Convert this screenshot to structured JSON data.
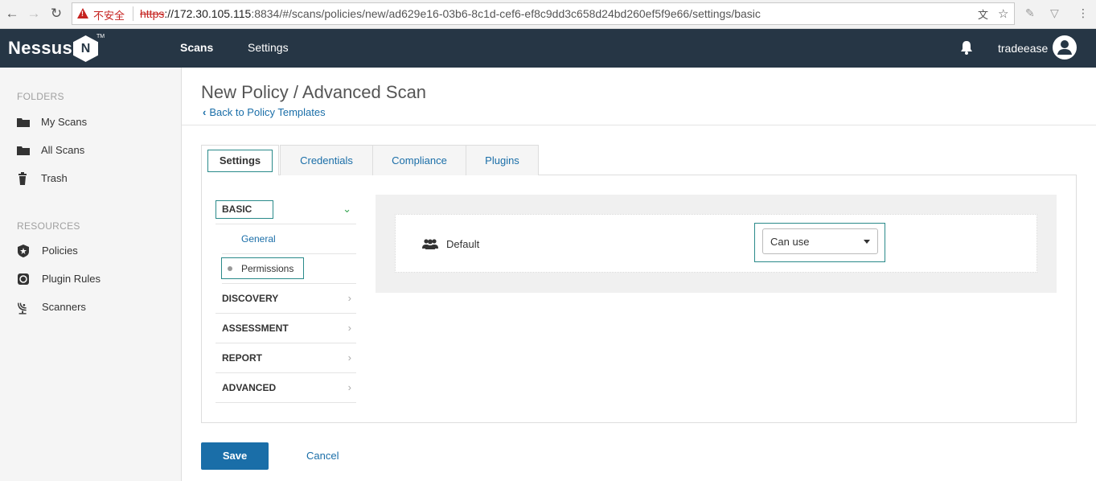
{
  "browser": {
    "insecure_label": "不安全",
    "url_scheme": "https",
    "url_host": "://172.30.105.115",
    "url_rest": ":8834/#/scans/policies/new/ad629e16-03b6-8c1d-cef6-ef8c9dd3c658d24bd260ef5f9e66/settings/basic"
  },
  "header": {
    "logo": "Nessus",
    "logo_mark": "N",
    "logo_tm": "TM",
    "nav": [
      "Scans",
      "Settings"
    ],
    "active_nav": "Scans",
    "username": "tradeease"
  },
  "sidebar": {
    "folders_heading": "FOLDERS",
    "folders": [
      {
        "label": "My Scans",
        "icon": "folder-icon"
      },
      {
        "label": "All Scans",
        "icon": "folder-icon"
      },
      {
        "label": "Trash",
        "icon": "trash-icon"
      }
    ],
    "resources_heading": "RESOURCES",
    "resources": [
      {
        "label": "Policies",
        "icon": "policies-icon"
      },
      {
        "label": "Plugin Rules",
        "icon": "plugin-rules-icon"
      },
      {
        "label": "Scanners",
        "icon": "scanners-icon"
      }
    ]
  },
  "page": {
    "title": "New Policy / Advanced Scan",
    "back_link": "Back to Policy Templates",
    "back_chevron": "‹"
  },
  "tabs": [
    "Settings",
    "Credentials",
    "Compliance",
    "Plugins"
  ],
  "active_tab": "Settings",
  "sections": {
    "basic": "BASIC",
    "basic_items": [
      "General",
      "Permissions"
    ],
    "current_item": "Permissions",
    "others": [
      "DISCOVERY",
      "ASSESSMENT",
      "REPORT",
      "ADVANCED"
    ],
    "chevron_open": "⌄",
    "chevron_closed": "›"
  },
  "permissions": {
    "name": "Default",
    "select_value": "Can use"
  },
  "actions": {
    "save": "Save",
    "cancel": "Cancel"
  }
}
